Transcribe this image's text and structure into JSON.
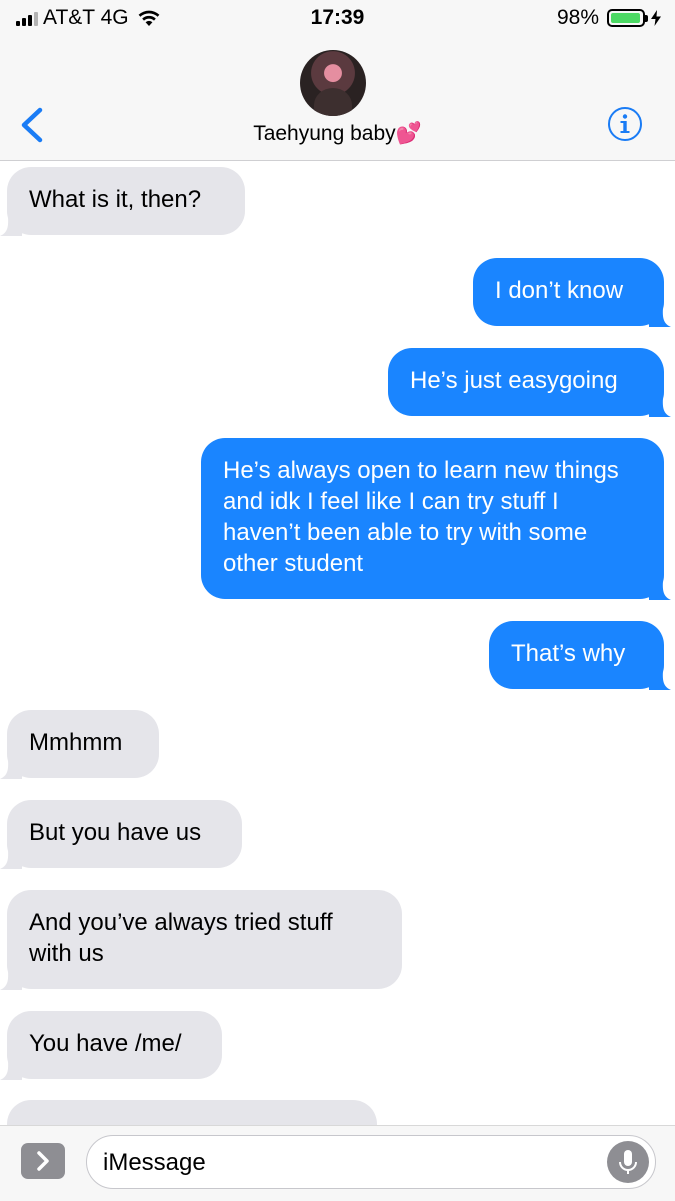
{
  "status_bar": {
    "carrier": "AT&T 4G",
    "time": "17:39",
    "battery": "98%"
  },
  "header": {
    "contact_name": "Taehyung baby💕"
  },
  "messages": [
    {
      "direction": "incoming",
      "text": "What is it, then?"
    },
    {
      "direction": "outgoing",
      "text": "I don’t know"
    },
    {
      "direction": "outgoing",
      "text": "He’s just easygoing"
    },
    {
      "direction": "outgoing",
      "text": "He’s always open to learn new things and idk I feel like I can try stuff I haven’t been able to try with some other student"
    },
    {
      "direction": "outgoing",
      "text": "That’s why"
    },
    {
      "direction": "incoming",
      "text": "Mmhmm"
    },
    {
      "direction": "incoming",
      "text": "But you have us"
    },
    {
      "direction": "incoming",
      "text": "And you’ve always tried stuff with us"
    },
    {
      "direction": "incoming",
      "text": "You have /me/"
    },
    {
      "direction": "incoming",
      "text": ""
    }
  ],
  "input": {
    "placeholder": "iMessage",
    "value": ""
  },
  "colors": {
    "outgoing_bubble": "#1a85ff",
    "incoming_bubble": "#e5e5ea",
    "accent": "#1a7cf5"
  }
}
